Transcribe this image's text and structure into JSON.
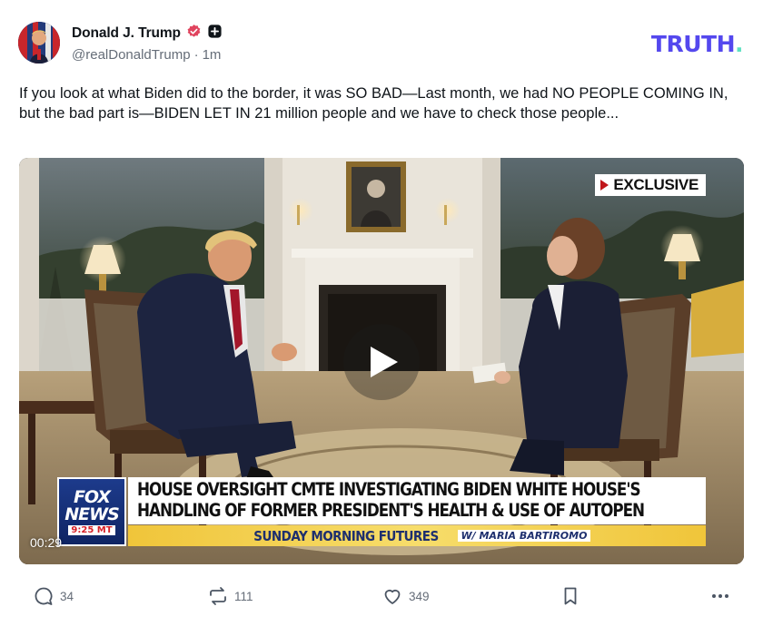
{
  "author": {
    "display_name": "Donald J. Trump",
    "handle": "@realDonaldTrump",
    "separator": "·",
    "time_ago": "1m",
    "verified_icon": "verified-badge-icon",
    "extra_icon": "plus-badge-icon"
  },
  "brand": {
    "logo_text": "TRUTH",
    "logo_dot": ".",
    "logo_color": "#5448ee",
    "dot_color": "#5ee1c2"
  },
  "post": {
    "text": "If you look at what Biden did to the border, it was SO BAD—Last month, we had NO PEOPLE COMING IN, but the bad part is—BIDEN LET IN 21 million people and we have to check those people..."
  },
  "video": {
    "exclusive_label": "EXCLUSIVE",
    "chyron_line1": "HOUSE OVERSIGHT CMTE INVESTIGATING BIDEN WHITE HOUSE'S",
    "chyron_line2": "HANDLING OF FORMER PRESIDENT'S HEALTH & USE OF AUTOPEN",
    "network_logo_line1": "FOX",
    "network_logo_line2": "NEWS",
    "network_time": "9:25 MT",
    "show_name": "SUNDAY MORNING FUTURES",
    "show_host": "W/ MARIA BARTIROMO",
    "duration": "00:29",
    "play_icon": "play-icon"
  },
  "actions": {
    "replies": "34",
    "retruths": "111",
    "likes": "349",
    "reply_icon": "comment-icon",
    "retruth_icon": "retruth-icon",
    "like_icon": "heart-icon",
    "bookmark_icon": "bookmark-icon",
    "more_icon": "more-icon"
  }
}
